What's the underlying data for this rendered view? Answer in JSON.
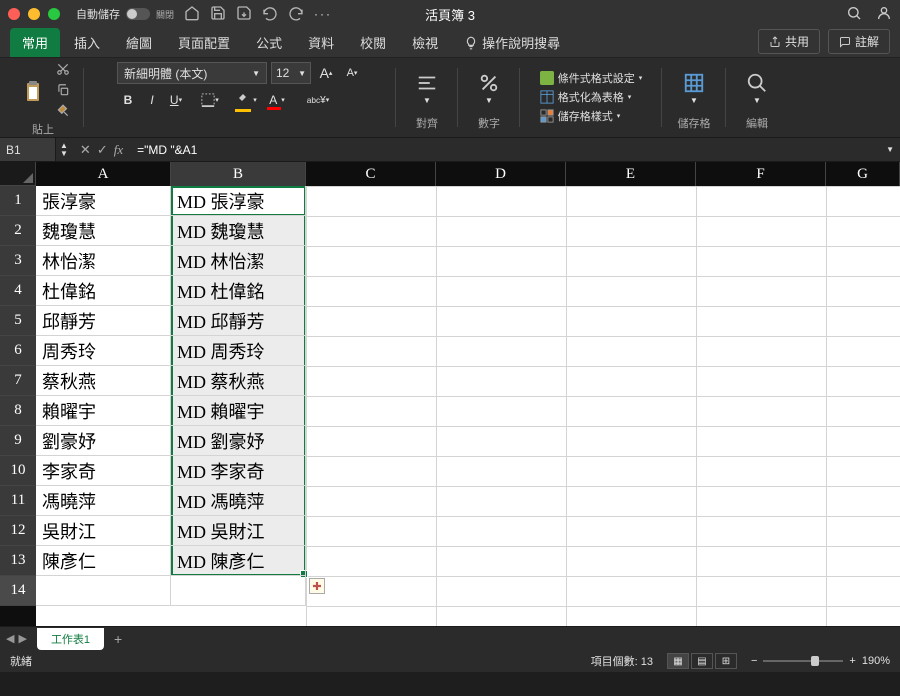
{
  "titlebar": {
    "autosave_label": "自動儲存",
    "autosave_state": "關閉",
    "doc_title": "活頁簿 3"
  },
  "tabs": {
    "home": "常用",
    "insert": "插入",
    "draw": "繪圖",
    "layout": "頁面配置",
    "formulas": "公式",
    "data": "資料",
    "review": "校閱",
    "view": "檢視",
    "tellme": "操作說明搜尋",
    "share": "共用",
    "comments": "註解"
  },
  "ribbon": {
    "paste": "貼上",
    "font_name": "新細明體 (本文)",
    "font_size": "12",
    "align": "對齊",
    "number": "數字",
    "cond_fmt": "條件式格式設定",
    "as_table": "格式化為表格",
    "cell_styles": "儲存格樣式",
    "cells": "儲存格",
    "editing": "編輯"
  },
  "formula_bar": {
    "name_box": "B1",
    "formula": "=\"MD \"&A1"
  },
  "columns": [
    "A",
    "B",
    "C",
    "D",
    "E",
    "F",
    "G"
  ],
  "rows": [
    {
      "n": "1",
      "a": "張淳豪",
      "b": "MD 張淳豪"
    },
    {
      "n": "2",
      "a": "魏瓊慧",
      "b": "MD 魏瓊慧"
    },
    {
      "n": "3",
      "a": "林怡潔",
      "b": "MD 林怡潔"
    },
    {
      "n": "4",
      "a": "杜偉銘",
      "b": "MD 杜偉銘"
    },
    {
      "n": "5",
      "a": "邱靜芳",
      "b": "MD 邱靜芳"
    },
    {
      "n": "6",
      "a": "周秀玲",
      "b": "MD 周秀玲"
    },
    {
      "n": "7",
      "a": "蔡秋燕",
      "b": "MD 蔡秋燕"
    },
    {
      "n": "8",
      "a": "賴曜宇",
      "b": "MD 賴曜宇"
    },
    {
      "n": "9",
      "a": "劉豪妤",
      "b": "MD 劉豪妤"
    },
    {
      "n": "10",
      "a": "李家奇",
      "b": "MD 李家奇"
    },
    {
      "n": "11",
      "a": "馮曉萍",
      "b": "MD 馮曉萍"
    },
    {
      "n": "12",
      "a": "吳財江",
      "b": "MD 吳財江"
    },
    {
      "n": "13",
      "a": "陳彥仁",
      "b": "MD 陳彥仁"
    },
    {
      "n": "14",
      "a": "",
      "b": ""
    }
  ],
  "sheet_tab": "工作表1",
  "status": {
    "ready": "就緒",
    "count_label": "項目個數: 13",
    "zoom": "190%"
  }
}
